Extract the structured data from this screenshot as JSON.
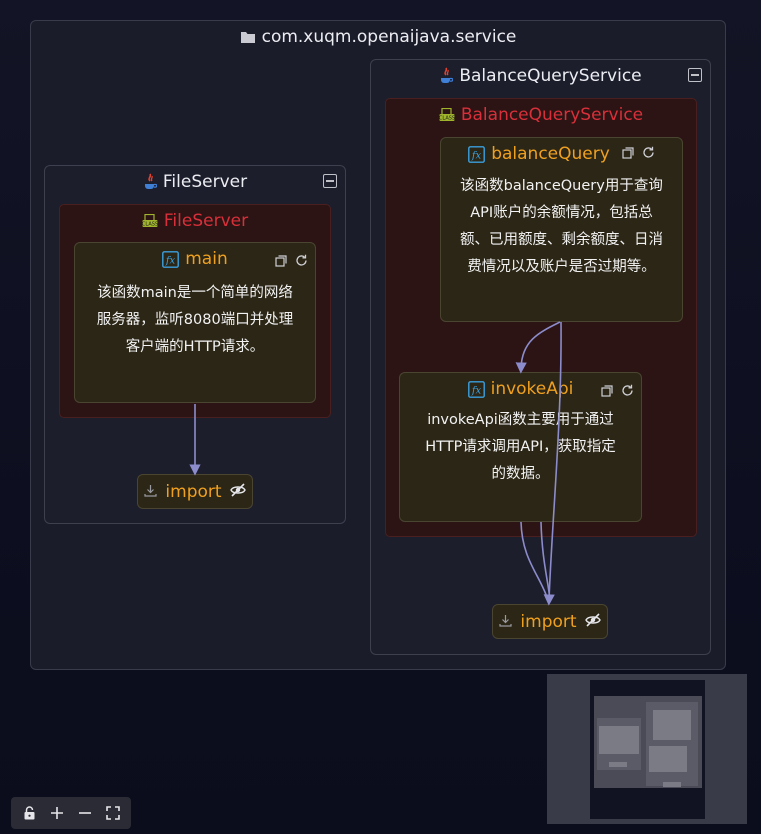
{
  "package": {
    "title": "com.xuqm.openaijava.service"
  },
  "file_server": {
    "service_title": "FileServer",
    "class_title": "FileServer",
    "function": {
      "name": "main",
      "description_lines": [
        "该函数main是一个简单的网络",
        "服务器，监听8080端口并处理",
        "客户端的HTTP请求。"
      ]
    },
    "import_label": "import"
  },
  "balance_service": {
    "service_title": "BalanceQueryService",
    "class_title": "BalanceQueryService",
    "function_balance": {
      "name": "balanceQuery",
      "description_lines": [
        "该函数balanceQuery用于查询",
        "API账户的余额情况，包括总",
        "额、已用额度、剩余额度、日消",
        "费情况以及账户是否过期等。"
      ]
    },
    "function_invoke": {
      "name": "invokeApi",
      "description_lines": [
        "invokeApi函数主要用于通过",
        "HTTP请求调用API，获取指定",
        "的数据。"
      ]
    },
    "import_label": "import"
  },
  "colors": {
    "class_title": "#d8303a",
    "function_title": "#f0a020",
    "edge": "#8c8ccc"
  },
  "icons": [
    "folder-icon",
    "java-icon",
    "class-icon",
    "function-icon",
    "copy-icon",
    "refresh-icon",
    "collapse-icon",
    "download-icon",
    "eye-off-icon",
    "lock-icon",
    "plus-icon",
    "minus-icon",
    "fullscreen-icon"
  ]
}
